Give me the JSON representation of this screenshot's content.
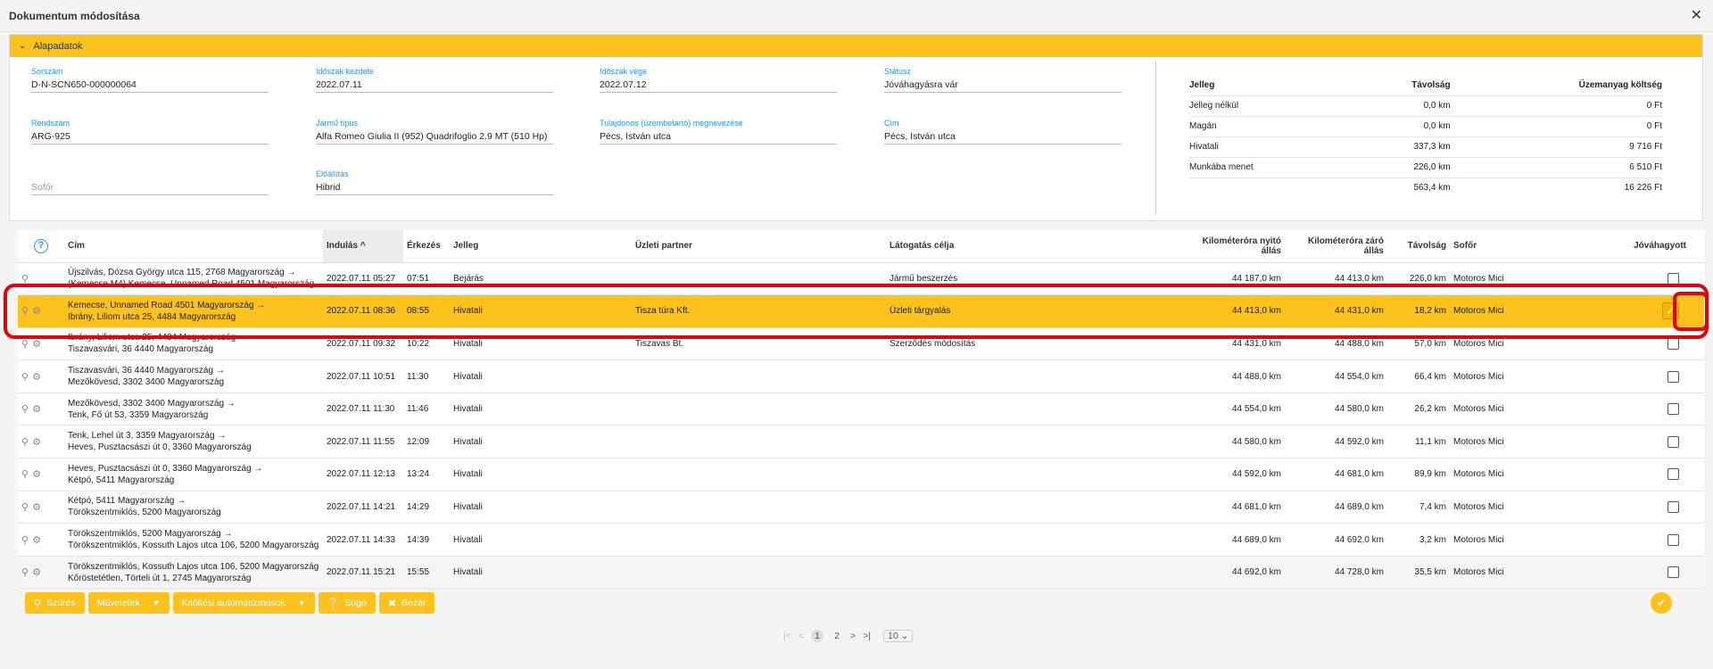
{
  "dialog": {
    "title": "Dokumentum módosítása",
    "close": "✕"
  },
  "panel": {
    "header": "Alapadatok",
    "fields": {
      "sorszam": {
        "label": "Sorszám",
        "value": "D-N-SCN650-000000064"
      },
      "kezdete": {
        "label": "Időszak kezdete",
        "value": "2022.07.11"
      },
      "vege": {
        "label": "Időszak vége",
        "value": "2022.07.12"
      },
      "statusz": {
        "label": "Státusz",
        "value": "Jóváhagyásra vár"
      },
      "rendszam": {
        "label": "Rendszám",
        "value": "ARG-925"
      },
      "jarmu": {
        "label": "Jármű típus",
        "value": "Alfa Romeo Giulia II (952) Quadrifoglio 2.9 MT (510 Hp)"
      },
      "tulajdonos": {
        "label": "Tulajdonos (üzembetartó) megnevezése",
        "value": "Pécs, István utca"
      },
      "cim": {
        "label": "Cím",
        "value": "Pécs, István utca"
      },
      "sofor": {
        "label": "",
        "value": "Sofőr"
      },
      "eloallitas": {
        "label": "Előállítás",
        "value": "Hibrid"
      }
    },
    "summary": {
      "headers": [
        "Jelleg",
        "Távolság",
        "Üzemanyag költség"
      ],
      "rows": [
        [
          "Jelleg nélkül",
          "0,0 km",
          "0 Ft"
        ],
        [
          "Magán",
          "0,0 km",
          "0 Ft"
        ],
        [
          "Hivatali",
          "337,3 km",
          "9 716 Ft"
        ],
        [
          "Munkába menet",
          "226,0 km",
          "6 510 Ft"
        ],
        [
          "",
          "563,4 km",
          "16 226 Ft"
        ]
      ]
    }
  },
  "grid": {
    "headers": [
      "Cím",
      "Indulás",
      "Érkezés",
      "Jelleg",
      "Üzleti partner",
      "Látogatás célja",
      "Kilométeróra nyitó állás",
      "Kilométeróra záró állás",
      "Távolság",
      "Sofőr",
      "Jóváhagyott"
    ],
    "sort_indicator": "^",
    "rows": [
      {
        "from": "Újszilvás, Dózsa György utca 115, 2768 Magyarország →",
        "to": "(Kemecse M4) Kemecse, Unnamed Road 4501 Magyarország",
        "start": "2022.07.11 05:27",
        "end": "07:51",
        "type": "Bejárás",
        "partner": "",
        "purpose": "Jármű beszerzés",
        "odo_open": "44 187,0 km",
        "odo_close": "44 413,0 km",
        "dist": "226,0 km",
        "driver": "Motoros Mici",
        "approved": false
      },
      {
        "from": "Kemecse, Unnamed Road 4501 Magyarország →",
        "to": "Ibrány, Liliom utca 25, 4484 Magyarország",
        "start": "2022.07.11 08:36",
        "end": "08:55",
        "type": "Hivatali",
        "partner": "Tisza túra Kft.",
        "purpose": "Üzleti tárgyalás",
        "odo_open": "44 413,0 km",
        "odo_close": "44 431,0 km",
        "dist": "18,2 km",
        "driver": "Motoros Mici",
        "approved": true
      },
      {
        "from": "Ibrány, Liliom utca 25, 4484 Magyarország →",
        "to": "Tiszavasvári, 36 4440 Magyarország",
        "start": "2022.07.11 09:32",
        "end": "10:22",
        "type": "Hivatali",
        "partner": "Tiszavas Bt.",
        "purpose": "Szerződés módosítás",
        "odo_open": "44 431,0 km",
        "odo_close": "44 488,0 km",
        "dist": "57,0 km",
        "driver": "Motoros Mici",
        "approved": false
      },
      {
        "from": "Tiszavasvári, 36 4440 Magyarország →",
        "to": "Mezőkövesd, 3302 3400 Magyarország",
        "start": "2022.07.11 10:51",
        "end": "11:30",
        "type": "Hivatali",
        "partner": "",
        "purpose": "",
        "odo_open": "44 488,0 km",
        "odo_close": "44 554,0 km",
        "dist": "66,4 km",
        "driver": "Motoros Mici",
        "approved": false
      },
      {
        "from": "Mezőkövesd, 3302 3400 Magyarország →",
        "to": "Tenk, Fő út 53, 3359 Magyarország",
        "start": "2022.07.11 11:30",
        "end": "11:46",
        "type": "Hivatali",
        "partner": "",
        "purpose": "",
        "odo_open": "44 554,0 km",
        "odo_close": "44 580,0 km",
        "dist": "26,2 km",
        "driver": "Motoros Mici",
        "approved": false
      },
      {
        "from": "Tenk, Lehel út 3, 3359 Magyarország →",
        "to": "Heves, Pusztacsászi út 0, 3360 Magyarország",
        "start": "2022.07.11 11:55",
        "end": "12:09",
        "type": "Hivatali",
        "partner": "",
        "purpose": "",
        "odo_open": "44 580,0 km",
        "odo_close": "44 592,0 km",
        "dist": "11,1 km",
        "driver": "Motoros Mici",
        "approved": false
      },
      {
        "from": "Heves, Pusztacsászi út 0, 3360 Magyarország →",
        "to": "Kétpó, 5411 Magyarország",
        "start": "2022.07.11 12:13",
        "end": "13:24",
        "type": "Hivatali",
        "partner": "",
        "purpose": "",
        "odo_open": "44 592,0 km",
        "odo_close": "44 681,0 km",
        "dist": "89,9 km",
        "driver": "Motoros Mici",
        "approved": false
      },
      {
        "from": "Kétpó, 5411 Magyarország →",
        "to": "Törökszentmiklós, 5200 Magyarország",
        "start": "2022.07.11 14:21",
        "end": "14:29",
        "type": "Hivatali",
        "partner": "",
        "purpose": "",
        "odo_open": "44 681,0 km",
        "odo_close": "44 689,0 km",
        "dist": "7,4 km",
        "driver": "Motoros Mici",
        "approved": false
      },
      {
        "from": "Törökszentmiklós, 5200 Magyarország →",
        "to": "Törökszentmiklós, Kossuth Lajos utca 106, 5200 Magyarország",
        "start": "2022.07.11 14:33",
        "end": "14:39",
        "type": "Hivatali",
        "partner": "",
        "purpose": "",
        "odo_open": "44 689,0 km",
        "odo_close": "44 692,0 km",
        "dist": "3,2 km",
        "driver": "Motoros Mici",
        "approved": false
      },
      {
        "from": "Törökszentmiklós, Kossuth Lajos utca 106, 5200 Magyarország →",
        "to": "Kőröstetétlen, Törteli út 1, 2745 Magyarország",
        "start": "2022.07.11 15:21",
        "end": "15:55",
        "type": "Hivatali",
        "partner": "",
        "purpose": "",
        "odo_open": "44 692,0 km",
        "odo_close": "44 728,0 km",
        "dist": "35,5 km",
        "driver": "Motoros Mici",
        "approved": false
      }
    ]
  },
  "toolbar": {
    "filter": "Szűrés",
    "actions": "Műveletek",
    "autofill": "Kitöltési automatizmusok",
    "help": "Súgó",
    "close": "Bezár"
  },
  "pager": {
    "pages": [
      "1",
      "2"
    ],
    "page_size": "10"
  },
  "colors": {
    "accent": "#fdc21c",
    "highlight": "#e0040f",
    "label": "#2196f3"
  }
}
